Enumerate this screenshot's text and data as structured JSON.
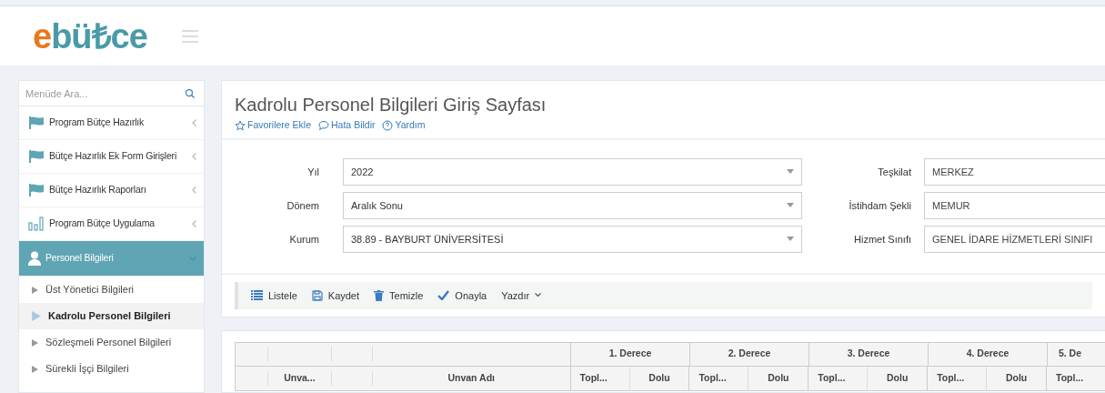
{
  "logo": {
    "first": "e",
    "rest": "bü₺ce"
  },
  "sidebar": {
    "search": {
      "placeholder": "Menüde Ara..."
    },
    "items": [
      {
        "kind": "flag",
        "label": "Program Bütçe Hazırlık",
        "expanded": false
      },
      {
        "kind": "flag",
        "label": "Bütçe Hazırlık Ek Form Girişleri",
        "expanded": false
      },
      {
        "kind": "flag",
        "label": "Bütçe Hazırlık Raporları",
        "expanded": false
      },
      {
        "kind": "chart",
        "label": "Program Bütçe Uygulama",
        "expanded": false
      },
      {
        "kind": "user",
        "label": "Personel Bilgileri",
        "expanded": true,
        "children": [
          {
            "label": "Üst Yönetici Bilgileri",
            "selected": false
          },
          {
            "label": "Kadrolu Personel Bilgileri",
            "selected": true
          },
          {
            "label": "Sözleşmeli Personel Bilgileri",
            "selected": false
          },
          {
            "label": "Sürekli İşçi Bilgileri",
            "selected": false
          }
        ]
      }
    ]
  },
  "page": {
    "title": "Kadrolu Personel Bilgileri Giriş Sayfası",
    "links": [
      {
        "kind": "star",
        "label": "Favorilere Ekle"
      },
      {
        "kind": "comment",
        "label": "Hata Bildir"
      },
      {
        "kind": "help",
        "label": "Yardım"
      }
    ]
  },
  "form": {
    "left": [
      {
        "label": "Yıl",
        "value": "2022"
      },
      {
        "label": "Dönem",
        "value": "Aralık Sonu"
      },
      {
        "label": "Kurum",
        "value": "38.89 - BAYBURT ÜNİVERSİTESİ"
      }
    ],
    "right": [
      {
        "label": "Teşkilat",
        "value": "MERKEZ"
      },
      {
        "label": "İstihdam Şekli",
        "value": "MEMUR"
      },
      {
        "label": "Hizmet Sınıfı",
        "value": "GENEL İDARE HİZMETLERİ SINIFI"
      }
    ]
  },
  "toolbar": [
    {
      "kind": "list",
      "label": "Listele"
    },
    {
      "kind": "save",
      "label": "Kaydet"
    },
    {
      "kind": "trash",
      "label": "Temizle"
    },
    {
      "kind": "check",
      "label": "Onayla"
    },
    {
      "kind": "dropdown",
      "label": "Yazdır"
    }
  ],
  "table": {
    "groups": [
      "1. Derece",
      "2. Derece",
      "3. Derece",
      "4. Derece",
      "5. De"
    ],
    "columns": [
      "Unva...",
      "Unvan Adı"
    ],
    "subcolumns": [
      "Topl...",
      "Dolu",
      "Topl...",
      "Dolu",
      "Topl...",
      "Dolu",
      "Topl...",
      "Dolu",
      "Topl..."
    ]
  }
}
